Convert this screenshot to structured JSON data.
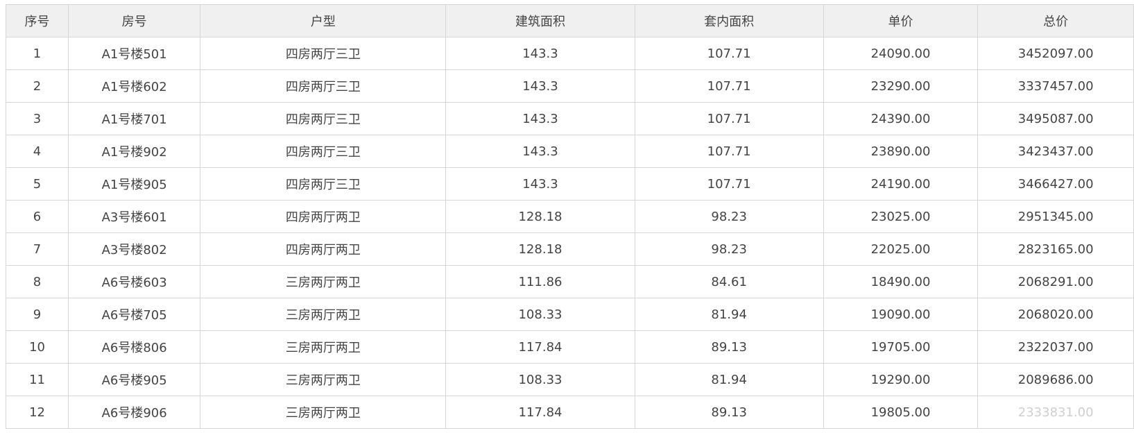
{
  "table": {
    "columns": [
      "序号",
      "房号",
      "户型",
      "建筑面积",
      "套内面积",
      "单价",
      "总价"
    ],
    "rows": [
      {
        "index": "1",
        "unit": "A1号楼501",
        "layout": "四房两厅三卫",
        "gross_area": "143.3",
        "net_area": "107.71",
        "unit_price": "24090.00",
        "total_price": "3452097.00"
      },
      {
        "index": "2",
        "unit": "A1号楼602",
        "layout": "四房两厅三卫",
        "gross_area": "143.3",
        "net_area": "107.71",
        "unit_price": "23290.00",
        "total_price": "3337457.00"
      },
      {
        "index": "3",
        "unit": "A1号楼701",
        "layout": "四房两厅三卫",
        "gross_area": "143.3",
        "net_area": "107.71",
        "unit_price": "24390.00",
        "total_price": "3495087.00"
      },
      {
        "index": "4",
        "unit": "A1号楼902",
        "layout": "四房两厅三卫",
        "gross_area": "143.3",
        "net_area": "107.71",
        "unit_price": "23890.00",
        "total_price": "3423437.00"
      },
      {
        "index": "5",
        "unit": "A1号楼905",
        "layout": "四房两厅三卫",
        "gross_area": "143.3",
        "net_area": "107.71",
        "unit_price": "24190.00",
        "total_price": "3466427.00"
      },
      {
        "index": "6",
        "unit": "A3号楼601",
        "layout": "四房两厅两卫",
        "gross_area": "128.18",
        "net_area": "98.23",
        "unit_price": "23025.00",
        "total_price": "2951345.00"
      },
      {
        "index": "7",
        "unit": "A3号楼802",
        "layout": "四房两厅两卫",
        "gross_area": "128.18",
        "net_area": "98.23",
        "unit_price": "22025.00",
        "total_price": "2823165.00"
      },
      {
        "index": "8",
        "unit": "A6号楼603",
        "layout": "三房两厅两卫",
        "gross_area": "111.86",
        "net_area": "84.61",
        "unit_price": "18490.00",
        "total_price": "2068291.00"
      },
      {
        "index": "9",
        "unit": "A6号楼705",
        "layout": "三房两厅两卫",
        "gross_area": "108.33",
        "net_area": "81.94",
        "unit_price": "19090.00",
        "total_price": "2068020.00"
      },
      {
        "index": "10",
        "unit": "A6号楼806",
        "layout": "三房两厅两卫",
        "gross_area": "117.84",
        "net_area": "89.13",
        "unit_price": "19705.00",
        "total_price": "2322037.00"
      },
      {
        "index": "11",
        "unit": "A6号楼905",
        "layout": "三房两厅两卫",
        "gross_area": "108.33",
        "net_area": "81.94",
        "unit_price": "19290.00",
        "total_price": "2089686.00"
      },
      {
        "index": "12",
        "unit": "A6号楼906",
        "layout": "三房两厅两卫",
        "gross_area": "117.84",
        "net_area": "89.13",
        "unit_price": "19805.00",
        "total_price": "2333831.00"
      }
    ]
  }
}
